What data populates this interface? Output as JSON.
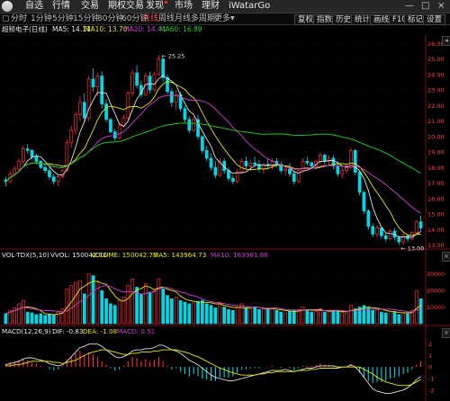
{
  "menu": {
    "items": [
      "自选",
      "行情",
      "交易",
      "期权交易",
      "发现",
      "市场",
      "理财",
      "iWatarGo"
    ],
    "window_buttons": [
      "—",
      "□",
      "×"
    ],
    "colors": {
      "bg": "#262626",
      "accent": "#ff2a2a"
    }
  },
  "toolbar": {
    "periods": [
      "分时",
      "1分钟",
      "5分钟",
      "15分钟",
      "30分钟",
      "60分钟",
      "日线",
      "周线",
      "月线",
      "多周期",
      "更多"
    ],
    "active_period": "日线",
    "right_buttons": [
      "复权",
      "指数",
      "历史",
      "统计",
      "画线",
      "F10",
      "标记",
      "设置"
    ]
  },
  "info": {
    "stock_name": "超频电子(日线)",
    "ma5": "MA5: 14.11",
    "ma10": "MA10: 13.70",
    "ma20": "MA20: 14.41",
    "ma60": "MA60: 16.89"
  },
  "volume_info": {
    "name": "VOL-TDX(5,10)",
    "vvol": "VVOL: 150042.70",
    "volume": "VOLUME: 150042.70",
    "ma5": "MA5: 143964.73",
    "ma10": "MA10: 163961.66"
  },
  "macd_info": {
    "name": "MACD(12,26,9)",
    "dif": "DIF: -0.83",
    "dea": "DEA: -1.08",
    "macd": "MACD: 0.51"
  },
  "chart_data": {
    "type": "candlestick",
    "price_axis": {
      "ticks": [
        "26.00",
        "25.00",
        "24.00",
        "23.00",
        "22.00",
        "21.00",
        "20.00",
        "19.00",
        "18.00",
        "17.00",
        "16.00",
        "15.00",
        "14.00",
        "13.00"
      ],
      "range": [
        12.8,
        26.6
      ]
    },
    "annotations": {
      "high": "25.25",
      "low": "13.00"
    },
    "volume_axis": {
      "ticks": [
        "30000",
        "20000",
        "10000"
      ],
      "range": [
        0,
        380000
      ]
    },
    "macd_axis": {
      "ticks": [
        "2",
        "1",
        "0",
        "-1",
        "-2"
      ],
      "range": [
        -2.8,
        2.6
      ]
    },
    "colors": {
      "up": "#ff3030",
      "down": "#00d8e8",
      "ma5": "#e0e0e0",
      "ma10": "#e8e800",
      "ma20": "#d040d0",
      "ma60": "#20d020"
    },
    "candles": [
      [
        17.2,
        17.4,
        16.8,
        17.1
      ],
      [
        17.1,
        17.8,
        17.0,
        17.6
      ],
      [
        17.6,
        18.1,
        17.4,
        17.9
      ],
      [
        17.9,
        18.6,
        17.7,
        18.4
      ],
      [
        18.4,
        19.4,
        18.2,
        19.2
      ],
      [
        19.2,
        19.5,
        18.9,
        19.1
      ],
      [
        19.1,
        19.2,
        18.5,
        18.7
      ],
      [
        18.7,
        18.9,
        18.2,
        18.4
      ],
      [
        18.4,
        18.5,
        17.9,
        18.0
      ],
      [
        18.0,
        18.3,
        17.6,
        17.8
      ],
      [
        17.8,
        18.0,
        17.2,
        17.4
      ],
      [
        17.4,
        17.6,
        16.9,
        17.1
      ],
      [
        17.1,
        17.5,
        16.8,
        17.4
      ],
      [
        17.4,
        17.9,
        17.3,
        17.8
      ],
      [
        17.8,
        19.8,
        17.8,
        19.6
      ],
      [
        19.6,
        20.7,
        19.3,
        20.4
      ],
      [
        20.4,
        21.6,
        20.1,
        21.4
      ],
      [
        21.4,
        22.6,
        21.0,
        22.2
      ],
      [
        22.2,
        22.8,
        20.9,
        21.2
      ],
      [
        21.2,
        23.9,
        21.0,
        23.7
      ],
      [
        23.7,
        24.4,
        22.9,
        23.2
      ],
      [
        23.2,
        24.1,
        22.6,
        23.9
      ],
      [
        23.9,
        24.2,
        21.8,
        22.1
      ],
      [
        22.1,
        22.4,
        20.9,
        21.1
      ],
      [
        21.1,
        21.2,
        20.2,
        20.3
      ],
      [
        20.3,
        20.5,
        19.7,
        19.9
      ],
      [
        19.9,
        20.9,
        19.8,
        20.7
      ],
      [
        20.7,
        21.4,
        20.6,
        21.2
      ],
      [
        21.2,
        22.9,
        21.1,
        22.8
      ],
      [
        22.8,
        24.3,
        22.6,
        24.1
      ],
      [
        24.1,
        24.6,
        23.1,
        23.3
      ],
      [
        23.3,
        23.6,
        22.5,
        22.7
      ],
      [
        22.7,
        24.1,
        22.6,
        23.9
      ],
      [
        23.9,
        24.2,
        22.8,
        23.0
      ],
      [
        23.0,
        24.2,
        22.9,
        24.0
      ],
      [
        24.0,
        25.25,
        23.9,
        25.0
      ],
      [
        25.0,
        25.1,
        23.5,
        23.8
      ],
      [
        23.8,
        24.0,
        22.7,
        22.9
      ],
      [
        22.9,
        23.1,
        21.9,
        22.2
      ],
      [
        22.2,
        23.0,
        21.7,
        22.7
      ],
      [
        22.7,
        22.9,
        21.6,
        21.8
      ],
      [
        21.8,
        22.0,
        20.9,
        21.1
      ],
      [
        21.1,
        21.3,
        20.2,
        20.4
      ],
      [
        20.4,
        21.3,
        20.3,
        21.1
      ],
      [
        21.1,
        21.4,
        19.8,
        20.0
      ],
      [
        20.0,
        20.1,
        18.9,
        19.1
      ],
      [
        19.1,
        19.4,
        18.4,
        18.6
      ],
      [
        18.6,
        18.9,
        17.8,
        18.0
      ],
      [
        18.0,
        18.4,
        17.3,
        17.5
      ],
      [
        17.5,
        18.6,
        17.4,
        18.4
      ],
      [
        18.4,
        18.6,
        17.6,
        17.8
      ],
      [
        17.8,
        18.0,
        17.1,
        17.3
      ],
      [
        17.3,
        17.5,
        16.9,
        17.1
      ],
      [
        17.1,
        17.9,
        17.0,
        17.7
      ],
      [
        17.7,
        18.6,
        17.6,
        18.4
      ],
      [
        18.4,
        18.7,
        17.9,
        18.1
      ],
      [
        18.1,
        18.5,
        17.8,
        18.3
      ],
      [
        18.3,
        18.7,
        18.0,
        18.2
      ],
      [
        18.2,
        18.5,
        17.7,
        17.9
      ],
      [
        17.9,
        18.3,
        17.6,
        18.2
      ],
      [
        18.2,
        18.6,
        17.9,
        18.1
      ],
      [
        18.1,
        18.6,
        17.9,
        18.4
      ],
      [
        18.4,
        18.6,
        18.0,
        18.2
      ],
      [
        18.2,
        18.4,
        17.6,
        17.8
      ],
      [
        17.8,
        18.1,
        17.5,
        17.9
      ],
      [
        17.9,
        18.3,
        17.4,
        17.6
      ],
      [
        17.6,
        17.8,
        16.9,
        17.1
      ],
      [
        17.1,
        17.9,
        17.0,
        17.8
      ],
      [
        17.8,
        18.6,
        17.7,
        18.4
      ],
      [
        18.4,
        18.7,
        18.1,
        18.3
      ],
      [
        18.3,
        18.4,
        17.9,
        18.1
      ],
      [
        18.1,
        18.5,
        17.9,
        18.4
      ],
      [
        18.4,
        19.0,
        18.2,
        18.8
      ],
      [
        18.8,
        18.9,
        18.2,
        18.4
      ],
      [
        18.4,
        18.8,
        18.1,
        18.6
      ],
      [
        18.6,
        18.8,
        17.9,
        18.1
      ],
      [
        18.1,
        18.4,
        17.4,
        17.6
      ],
      [
        17.6,
        18.0,
        17.3,
        17.8
      ],
      [
        17.8,
        18.2,
        17.6,
        18.0
      ],
      [
        18.0,
        19.3,
        17.9,
        19.1
      ],
      [
        19.1,
        19.2,
        17.5,
        17.7
      ],
      [
        17.7,
        17.8,
        16.2,
        16.4
      ],
      [
        16.4,
        16.5,
        15.0,
        15.2
      ],
      [
        15.2,
        15.3,
        14.0,
        14.2
      ],
      [
        14.2,
        14.4,
        13.5,
        13.7
      ],
      [
        13.7,
        14.3,
        13.5,
        14.1
      ],
      [
        14.1,
        14.2,
        13.4,
        13.6
      ],
      [
        13.6,
        13.8,
        13.2,
        13.4
      ],
      [
        13.4,
        14.0,
        13.3,
        13.9
      ],
      [
        13.9,
        14.1,
        13.3,
        13.5
      ],
      [
        13.5,
        13.6,
        13.0,
        13.2
      ],
      [
        13.2,
        13.8,
        13.0,
        13.6
      ],
      [
        13.6,
        13.7,
        13.2,
        13.4
      ],
      [
        13.4,
        13.9,
        13.3,
        13.8
      ],
      [
        13.8,
        14.6,
        13.7,
        14.5
      ],
      [
        14.5,
        14.9,
        13.9,
        14.1
      ]
    ],
    "volumes": [
      60000,
      80000,
      95000,
      120000,
      140000,
      70000,
      65000,
      55000,
      60000,
      50000,
      58000,
      52000,
      70000,
      90000,
      210000,
      230000,
      250000,
      260000,
      180000,
      300000,
      290000,
      250000,
      200000,
      150000,
      120000,
      110000,
      140000,
      160000,
      230000,
      270000,
      220000,
      180000,
      240000,
      190000,
      200000,
      270000,
      210000,
      170000,
      150000,
      160000,
      140000,
      130000,
      120000,
      125000,
      135000,
      140000,
      120000,
      110000,
      95000,
      130000,
      100000,
      85000,
      80000,
      100000,
      120000,
      95000,
      90000,
      100000,
      85000,
      90000,
      88000,
      95000,
      80000,
      70000,
      65000,
      75000,
      80000,
      85000,
      100000,
      85000,
      70000,
      75000,
      90000,
      70000,
      72000,
      80000,
      75000,
      68000,
      65000,
      110000,
      90000,
      100000,
      110000,
      95000,
      80000,
      85000,
      70000,
      65000,
      75000,
      70000,
      55000,
      65000,
      60000,
      80000,
      200000,
      150000
    ],
    "macd": [
      0.3,
      0.4,
      0.5,
      0.6,
      0.7,
      0.6,
      0.4,
      0.3,
      0.1,
      0.0,
      -0.2,
      -0.3,
      -0.2,
      0.1,
      0.6,
      0.9,
      1.2,
      1.4,
      1.0,
      1.3,
      1.1,
      0.9,
      0.5,
      0.2,
      -0.1,
      -0.3,
      -0.2,
      0.1,
      0.5,
      0.9,
      0.8,
      0.5,
      0.7,
      0.5,
      0.6,
      0.9,
      0.5,
      0.1,
      -0.2,
      -0.1,
      -0.4,
      -0.6,
      -0.8,
      -0.6,
      -0.8,
      -1.0,
      -1.1,
      -1.2,
      -1.2,
      -0.9,
      -0.9,
      -0.9,
      -0.8,
      -0.5,
      -0.2,
      -0.2,
      -0.1,
      -0.1,
      -0.1,
      0.0,
      0.0,
      0.1,
      0.0,
      -0.1,
      0.0,
      -0.1,
      -0.3,
      -0.1,
      0.1,
      0.1,
      0.1,
      0.2,
      0.3,
      0.2,
      0.2,
      0.1,
      -0.1,
      0.0,
      0.0,
      0.3,
      -0.1,
      -0.5,
      -0.9,
      -1.2,
      -1.4,
      -1.3,
      -1.3,
      -1.2,
      -1.0,
      -0.9,
      -0.8,
      -0.6,
      -0.5,
      -0.2,
      0.2,
      0.5
    ],
    "macd_lines": {
      "dif": [
        0.2,
        0.3,
        0.4,
        0.5,
        0.7,
        0.8,
        0.8,
        0.7,
        0.6,
        0.5,
        0.3,
        0.2,
        0.1,
        0.2,
        0.5,
        0.9,
        1.3,
        1.7,
        1.8,
        2.0,
        2.0,
        2.0,
        1.8,
        1.5,
        1.2,
        0.9,
        0.8,
        0.9,
        1.1,
        1.4,
        1.5,
        1.5,
        1.6,
        1.6,
        1.7,
        1.9,
        1.9,
        1.7,
        1.5,
        1.4,
        1.2,
        0.9,
        0.6,
        0.4,
        0.2,
        -0.1,
        -0.4,
        -0.7,
        -0.9,
        -1.0,
        -1.1,
        -1.2,
        -1.2,
        -1.1,
        -1.0,
        -0.9,
        -0.8,
        -0.7,
        -0.6,
        -0.5,
        -0.4,
        -0.3,
        -0.3,
        -0.3,
        -0.2,
        -0.3,
        -0.4,
        -0.3,
        -0.2,
        -0.1,
        -0.1,
        0.0,
        0.1,
        0.1,
        0.1,
        0.1,
        0.0,
        0.0,
        0.0,
        0.2,
        0.0,
        -0.4,
        -0.9,
        -1.4,
        -1.9,
        -2.1,
        -2.2,
        -2.3,
        -2.3,
        -2.2,
        -2.1,
        -2.0,
        -1.8,
        -1.5,
        -1.1,
        -0.83
      ],
      "dea": [
        0.1,
        0.1,
        0.2,
        0.2,
        0.3,
        0.4,
        0.5,
        0.5,
        0.5,
        0.5,
        0.5,
        0.4,
        0.4,
        0.3,
        0.4,
        0.5,
        0.6,
        0.8,
        1.0,
        1.2,
        1.3,
        1.4,
        1.5,
        1.5,
        1.4,
        1.3,
        1.2,
        1.1,
        1.1,
        1.2,
        1.2,
        1.3,
        1.3,
        1.3,
        1.4,
        1.4,
        1.5,
        1.5,
        1.5,
        1.5,
        1.4,
        1.3,
        1.2,
        1.0,
        0.9,
        0.7,
        0.5,
        0.3,
        0.1,
        -0.1,
        -0.2,
        -0.4,
        -0.5,
        -0.6,
        -0.7,
        -0.7,
        -0.7,
        -0.7,
        -0.6,
        -0.6,
        -0.5,
        -0.5,
        -0.4,
        -0.4,
        -0.4,
        -0.4,
        -0.4,
        -0.3,
        -0.3,
        -0.3,
        -0.2,
        -0.2,
        -0.1,
        -0.1,
        -0.1,
        -0.1,
        -0.1,
        0.0,
        0.0,
        0.0,
        0.0,
        0.0,
        -0.2,
        -0.4,
        -0.6,
        -0.9,
        -1.1,
        -1.3,
        -1.4,
        -1.5,
        -1.6,
        -1.6,
        -1.6,
        -1.5,
        -1.3,
        -1.08
      ]
    }
  }
}
